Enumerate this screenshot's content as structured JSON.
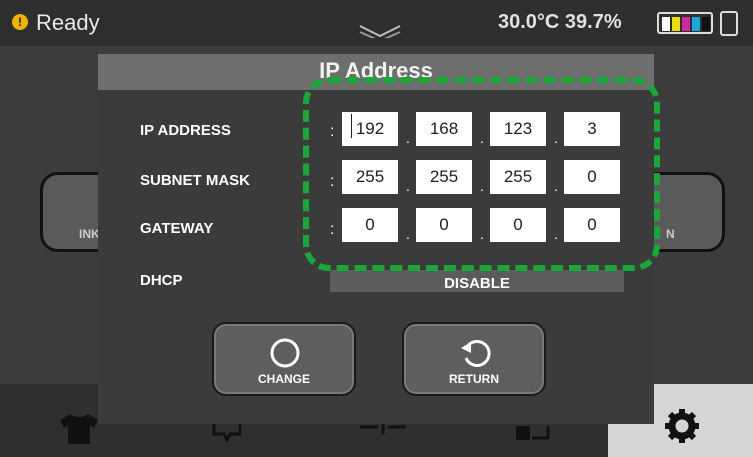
{
  "status": {
    "indicator_glyph": "!",
    "state": "Ready",
    "environment": "30.0°C 39.7%",
    "indicator_color": "#f0b400"
  },
  "background_screen": {
    "left_button_label": "INK",
    "right_button_label": "N"
  },
  "dialog": {
    "title": "IP Address",
    "rows": [
      {
        "label": "IP ADDRESS",
        "octets": [
          "192",
          "168",
          "123",
          "3"
        ]
      },
      {
        "label": "SUBNET MASK",
        "octets": [
          "255",
          "255",
          "255",
          "0"
        ]
      },
      {
        "label": "GATEWAY",
        "octets": [
          "0",
          "0",
          "0",
          "0"
        ]
      }
    ],
    "separator": ":",
    "octet_dot": ".",
    "dhcp": {
      "label": "DHCP",
      "value": "DISABLE"
    },
    "buttons": {
      "change": "CHANGE",
      "return": "RETURN"
    }
  },
  "icons": [
    "warning-icon",
    "menu-chevron-icon",
    "ink-level-icon",
    "battery-icon",
    "circle-icon",
    "refresh-icon",
    "tshirt-icon",
    "tray-icon",
    "align-icon",
    "print-head-icon",
    "gear-icon"
  ],
  "colors": {
    "highlight": "#18a838",
    "footer_selected": "#d5d5d5"
  }
}
